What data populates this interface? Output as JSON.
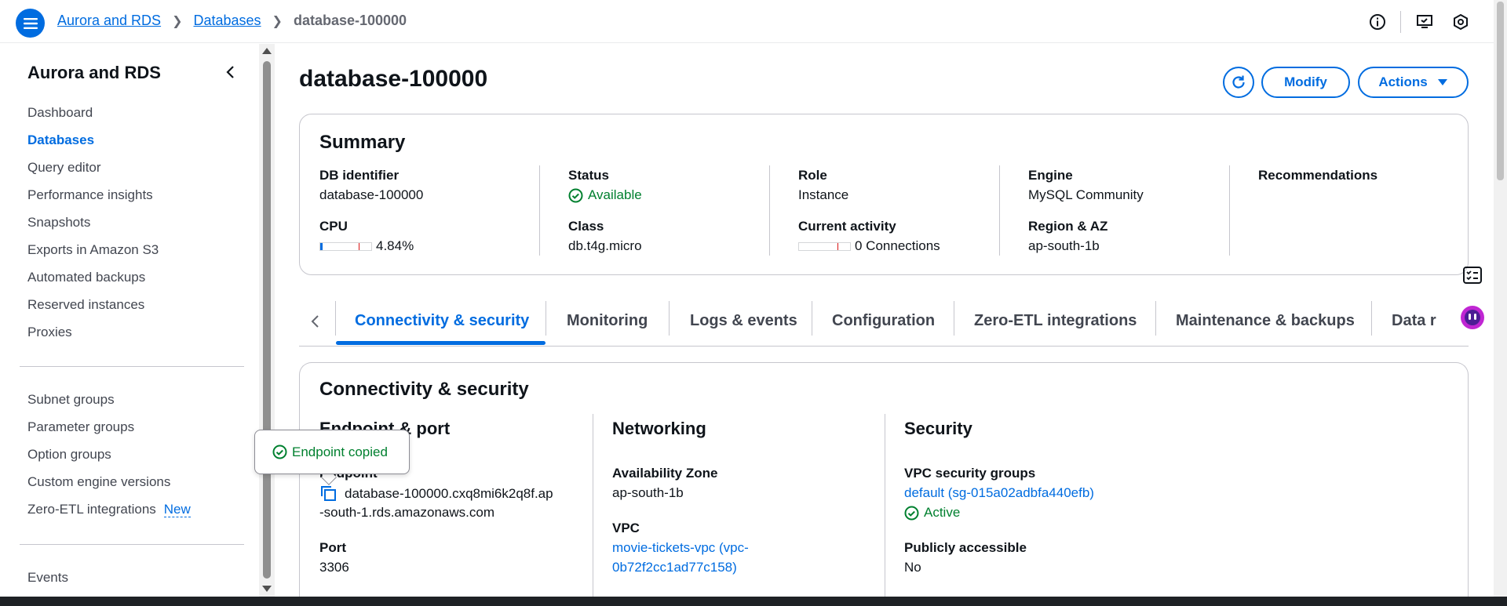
{
  "breadcrumb": {
    "item1": "Aurora and RDS",
    "item2": "Databases",
    "current": "database-100000"
  },
  "sidebar": {
    "title": "Aurora and RDS",
    "items": [
      {
        "label": "Dashboard"
      },
      {
        "label": "Databases"
      },
      {
        "label": "Query editor"
      },
      {
        "label": "Performance insights"
      },
      {
        "label": "Snapshots"
      },
      {
        "label": "Exports in Amazon S3"
      },
      {
        "label": "Automated backups"
      },
      {
        "label": "Reserved instances"
      },
      {
        "label": "Proxies"
      }
    ],
    "items2": [
      {
        "label": "Subnet groups"
      },
      {
        "label": "Parameter groups"
      },
      {
        "label": "Option groups"
      },
      {
        "label": "Custom engine versions"
      },
      {
        "label": "Zero-ETL integrations",
        "badge": "New"
      }
    ],
    "items3": [
      {
        "label": "Events"
      }
    ]
  },
  "page": {
    "title": "database-100000",
    "modify_label": "Modify",
    "actions_label": "Actions"
  },
  "summary": {
    "title": "Summary",
    "db_identifier_label": "DB identifier",
    "db_identifier": "database-100000",
    "cpu_label": "CPU",
    "cpu_value": "4.84%",
    "cpu_fraction": 0.0484,
    "status_label": "Status",
    "status": "Available",
    "class_label": "Class",
    "class": "db.t4g.micro",
    "role_label": "Role",
    "role": "Instance",
    "activity_label": "Current activity",
    "activity": "0 Connections",
    "engine_label": "Engine",
    "engine": "MySQL Community",
    "region_label": "Region & AZ",
    "region": "ap-south-1b",
    "recommendations_label": "Recommendations"
  },
  "tabs": [
    {
      "label": "Connectivity & security",
      "active": true
    },
    {
      "label": "Monitoring"
    },
    {
      "label": "Logs & events"
    },
    {
      "label": "Configuration"
    },
    {
      "label": "Zero-ETL integrations"
    },
    {
      "label": "Maintenance & backups"
    },
    {
      "label": "Data r"
    }
  ],
  "connectivity": {
    "title": "Connectivity & security",
    "endpoint_section": "Endpoint & port",
    "endpoint_label": "Endpoint",
    "endpoint_line1": "database-100000.cxq8mi6k2q8f.ap",
    "endpoint_line2": "-south-1.rds.amazonaws.com",
    "port_label": "Port",
    "port": "3306",
    "networking_section": "Networking",
    "az_label": "Availability Zone",
    "az": "ap-south-1b",
    "vpc_label": "VPC",
    "vpc_line1": "movie-tickets-vpc (vpc-",
    "vpc_line2": "0b72f2cc1ad77c158)",
    "security_section": "Security",
    "sg_label": "VPC security groups",
    "sg_value": "default (sg-015a02adbfa440efb)",
    "sg_status": "Active",
    "public_label": "Publicly accessible",
    "public_value": "No"
  },
  "tooltip": {
    "text": "Endpoint copied"
  },
  "colors": {
    "accent": "#006ce0",
    "success": "#00802f",
    "border": "#c6c6cd"
  }
}
